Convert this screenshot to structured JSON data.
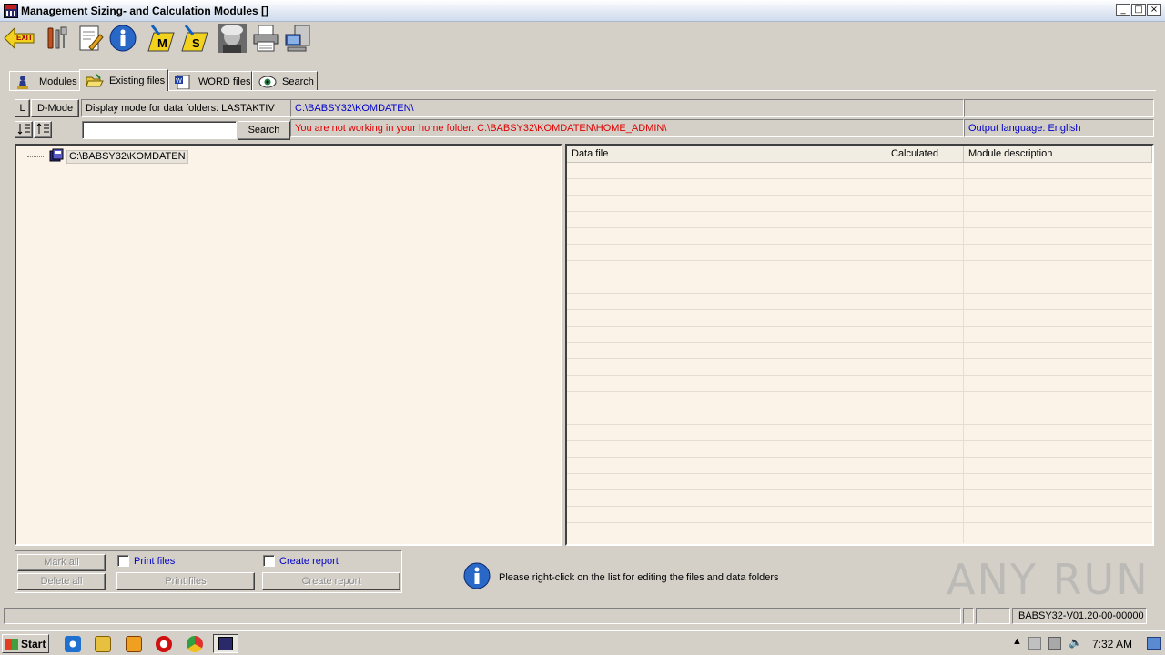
{
  "window": {
    "title": "Management Sizing- and Calculation Modules []",
    "controls": [
      "_",
      "□",
      "×"
    ]
  },
  "toolbar": {
    "icons": [
      "exit-icon",
      "tools-icon",
      "notepad-edit-icon",
      "info-icon",
      "module-m-icon",
      "module-s-icon",
      "einstein-portrait-icon",
      "printer-icon",
      "network-computer-icon"
    ],
    "exit_label": "EXIT",
    "m_label": "M",
    "s_label": "S"
  },
  "tabs": [
    {
      "label": "Modules",
      "icon": "chess-piece-icon"
    },
    {
      "label": "Existing files",
      "icon": "open-folder-icon",
      "active": true
    },
    {
      "label": "WORD files",
      "icon": "word-document-icon"
    },
    {
      "label": "Search",
      "icon": "search-eye-icon"
    }
  ],
  "info": {
    "l_button": "L",
    "dmode_button": "D-Mode",
    "display_mode_text": "Display mode for data folders: LASTAKTIV",
    "data_path": "C:\\BABSY32\\KOMDATEN\\",
    "search_value": "",
    "search_button": "Search",
    "warning": "You are not working in your home folder: C:\\BABSY32\\KOMDATEN\\HOME_ADMIN\\",
    "output_language": "Output language: English"
  },
  "tree": {
    "root_label": "C:\\BABSY32\\KOMDATEN"
  },
  "grid": {
    "columns": [
      "Data file",
      "Calculated",
      "Module description"
    ],
    "rows": []
  },
  "actions": {
    "mark_all": "Mark all",
    "delete_all": "Delete all",
    "print_files_check": "Print files",
    "print_files_button": "Print files",
    "create_report_check": "Create report",
    "create_report_button": "Create report",
    "hint": "Please right-click on the list for editing the files and data folders"
  },
  "status": {
    "version": "BABSY32-V01.20-00-00000"
  },
  "watermark": "ANY RUN",
  "taskbar": {
    "start_label": "Start",
    "clock": "7:32 AM"
  }
}
